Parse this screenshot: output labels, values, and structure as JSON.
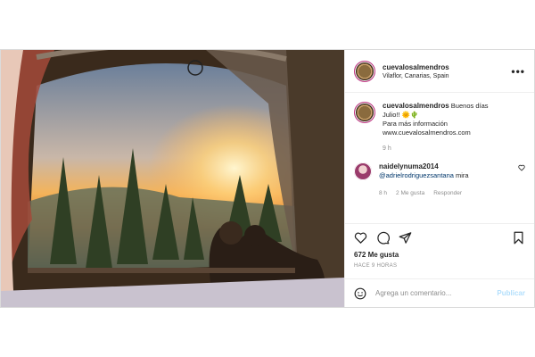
{
  "post": {
    "username": "cuevalosalmendros",
    "location": "Vilaflor, Canarias, Spain",
    "caption_user": "cuevalosalmendros",
    "caption_line1": "Buenos días",
    "caption_line2": "Julio!! 🌞🌵",
    "caption_line3": "Para más información",
    "caption_link": "www.cuevalosalmendros.com",
    "caption_time": "9 h",
    "comment": {
      "user": "naidelynuma2014",
      "mention": "@adrielrodriguezsantana",
      "text": "mira",
      "time": "8 h",
      "likes": "2 Me gusta",
      "reply": "Responder"
    },
    "likes": "672 Me gusta",
    "ago": "HACE 9 HORAS",
    "add_comment_placeholder": "Agrega un comentario...",
    "publish": "Publicar"
  },
  "icons": [
    "more-icon",
    "heart-icon",
    "comment-icon",
    "share-icon",
    "bookmark-icon",
    "smiley-icon"
  ]
}
